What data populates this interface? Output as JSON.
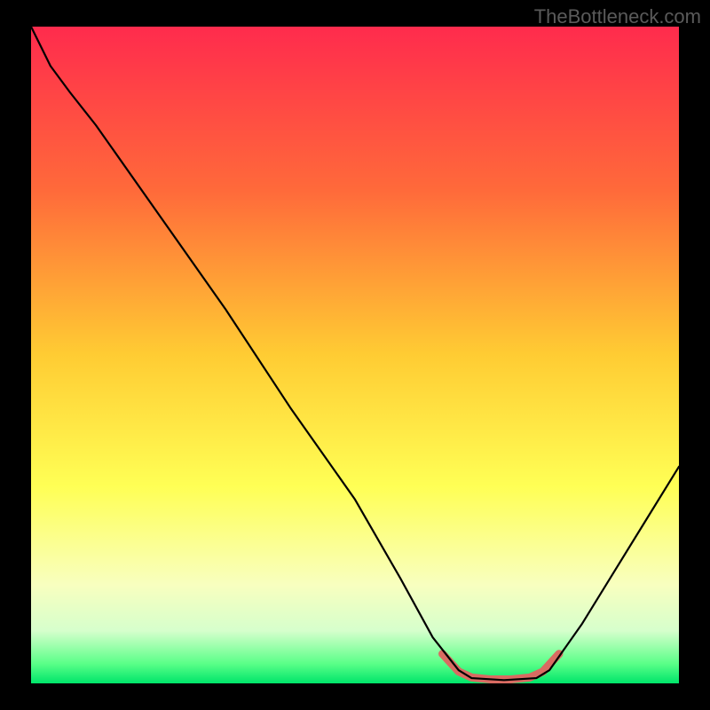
{
  "watermark": "TheBottleneck.com",
  "chart_data": {
    "type": "line",
    "title": "",
    "xlabel": "",
    "ylabel": "",
    "xlim": [
      0,
      100
    ],
    "ylim": [
      0,
      100
    ],
    "background_gradient": {
      "stops": [
        {
          "offset": 0.0,
          "color": "#ff2b4d"
        },
        {
          "offset": 0.25,
          "color": "#ff6a3a"
        },
        {
          "offset": 0.5,
          "color": "#ffcc33"
        },
        {
          "offset": 0.7,
          "color": "#ffff55"
        },
        {
          "offset": 0.85,
          "color": "#f8ffbf"
        },
        {
          "offset": 0.92,
          "color": "#d6ffcc"
        },
        {
          "offset": 0.97,
          "color": "#5aff88"
        },
        {
          "offset": 1.0,
          "color": "#00e56a"
        }
      ]
    },
    "series": [
      {
        "name": "curve",
        "color": "#000000",
        "width": 2.2,
        "points": [
          {
            "x": 0,
            "y": 100
          },
          {
            "x": 3,
            "y": 94
          },
          {
            "x": 6,
            "y": 90
          },
          {
            "x": 10,
            "y": 85
          },
          {
            "x": 20,
            "y": 71
          },
          {
            "x": 30,
            "y": 57
          },
          {
            "x": 40,
            "y": 42
          },
          {
            "x": 50,
            "y": 28
          },
          {
            "x": 57,
            "y": 16
          },
          {
            "x": 62,
            "y": 7
          },
          {
            "x": 66,
            "y": 2
          },
          {
            "x": 68,
            "y": 0.8
          },
          {
            "x": 73,
            "y": 0.5
          },
          {
            "x": 78,
            "y": 0.8
          },
          {
            "x": 80,
            "y": 2
          },
          {
            "x": 85,
            "y": 9
          },
          {
            "x": 90,
            "y": 17
          },
          {
            "x": 95,
            "y": 25
          },
          {
            "x": 100,
            "y": 33
          }
        ]
      },
      {
        "name": "bottom-highlight",
        "color": "#d96b62",
        "width": 9,
        "points": [
          {
            "x": 63.5,
            "y": 4.5
          },
          {
            "x": 66,
            "y": 1.8
          },
          {
            "x": 68,
            "y": 0.9
          },
          {
            "x": 71,
            "y": 0.6
          },
          {
            "x": 74,
            "y": 0.6
          },
          {
            "x": 77,
            "y": 0.9
          },
          {
            "x": 79,
            "y": 1.8
          },
          {
            "x": 81.5,
            "y": 4.5
          }
        ]
      }
    ]
  }
}
